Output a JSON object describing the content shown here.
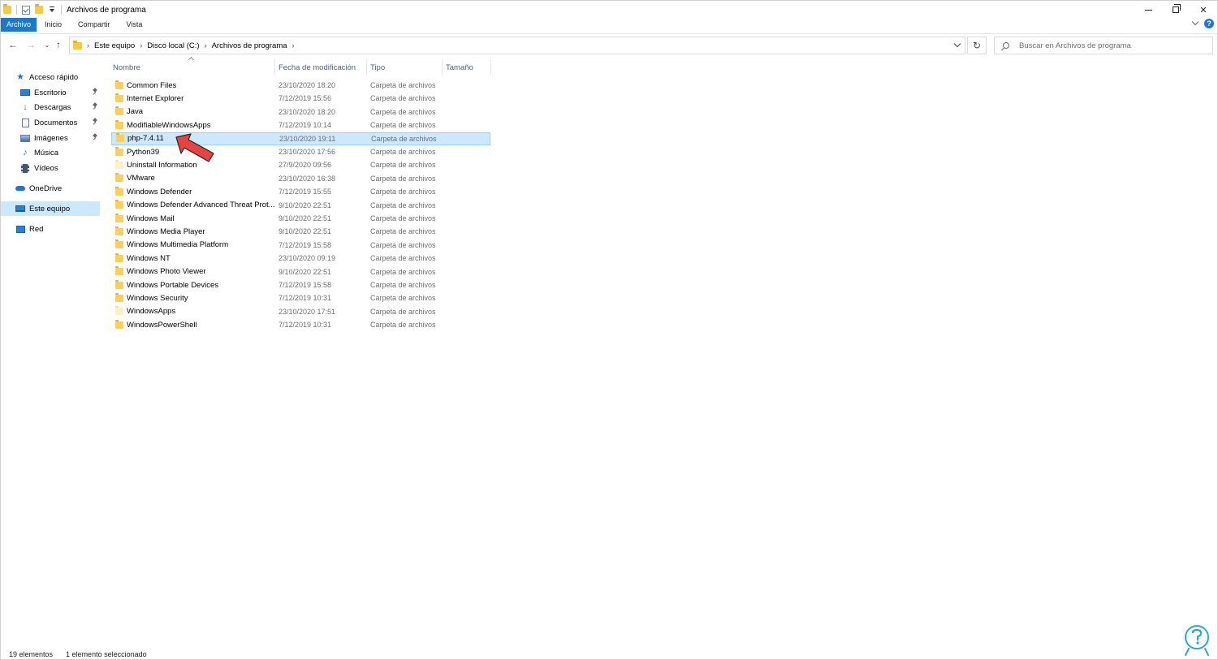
{
  "window": {
    "title": "Archivos de programa"
  },
  "ribbon": {
    "tabs": [
      "Archivo",
      "Inicio",
      "Compartir",
      "Vista"
    ]
  },
  "address": {
    "crumbs": [
      "Este equipo",
      "Disco local (C:)",
      "Archivos de programa"
    ]
  },
  "search": {
    "placeholder": "Buscar en Archivos de programa"
  },
  "sidebar": {
    "items": [
      {
        "label": "Acceso rápido",
        "icon": "star-icon"
      },
      {
        "label": "Escritorio",
        "icon": "desktop-icon",
        "pinned": true
      },
      {
        "label": "Descargas",
        "icon": "download-icon",
        "pinned": true
      },
      {
        "label": "Documentos",
        "icon": "documents-icon",
        "pinned": true
      },
      {
        "label": "Imágenes",
        "icon": "images-icon",
        "pinned": true
      },
      {
        "label": "Música",
        "icon": "music-icon"
      },
      {
        "label": "Vídeos",
        "icon": "videos-icon"
      },
      {
        "label": "OneDrive",
        "icon": "cloud-icon"
      },
      {
        "label": "Este equipo",
        "icon": "computer-icon",
        "selected": true
      },
      {
        "label": "Red",
        "icon": "network-icon"
      }
    ]
  },
  "columns": {
    "name": "Nombre",
    "date": "Fecha de modificación",
    "type": "Tipo",
    "size": "Tamaño"
  },
  "files": [
    {
      "name": "Common Files",
      "date": "23/10/2020 18:20",
      "type": "Carpeta de archivos"
    },
    {
      "name": "Internet Explorer",
      "date": "7/12/2019 15:56",
      "type": "Carpeta de archivos"
    },
    {
      "name": "Java",
      "date": "23/10/2020 18:20",
      "type": "Carpeta de archivos"
    },
    {
      "name": "ModifiableWindowsApps",
      "date": "7/12/2019 10:14",
      "type": "Carpeta de archivos"
    },
    {
      "name": "php-7.4.11",
      "date": "23/10/2020 19:11",
      "type": "Carpeta de archivos",
      "selected": true
    },
    {
      "name": "Python39",
      "date": "23/10/2020 17:56",
      "type": "Carpeta de archivos"
    },
    {
      "name": "Uninstall Information",
      "date": "27/9/2020 09:56",
      "type": "Carpeta de archivos",
      "pale": true
    },
    {
      "name": "VMware",
      "date": "23/10/2020 16:38",
      "type": "Carpeta de archivos"
    },
    {
      "name": "Windows Defender",
      "date": "7/12/2019 15:55",
      "type": "Carpeta de archivos"
    },
    {
      "name": "Windows Defender Advanced Threat Prot...",
      "date": "9/10/2020 22:51",
      "type": "Carpeta de archivos"
    },
    {
      "name": "Windows Mail",
      "date": "9/10/2020 22:51",
      "type": "Carpeta de archivos"
    },
    {
      "name": "Windows Media Player",
      "date": "9/10/2020 22:51",
      "type": "Carpeta de archivos"
    },
    {
      "name": "Windows Multimedia Platform",
      "date": "7/12/2019 15:58",
      "type": "Carpeta de archivos"
    },
    {
      "name": "Windows NT",
      "date": "23/10/2020 09:19",
      "type": "Carpeta de archivos"
    },
    {
      "name": "Windows Photo Viewer",
      "date": "9/10/2020 22:51",
      "type": "Carpeta de archivos"
    },
    {
      "name": "Windows Portable Devices",
      "date": "7/12/2019 15:58",
      "type": "Carpeta de archivos"
    },
    {
      "name": "Windows Security",
      "date": "7/12/2019 10:31",
      "type": "Carpeta de archivos"
    },
    {
      "name": "WindowsApps",
      "date": "23/10/2020 17:51",
      "type": "Carpeta de archivos",
      "pale": true
    },
    {
      "name": "WindowsPowerShell",
      "date": "7/12/2019 10:31",
      "type": "Carpeta de archivos"
    }
  ],
  "status": {
    "count": "19 elementos",
    "selection": "1 elemento seleccionado"
  },
  "colors": {
    "accent": "#1979ca",
    "selection": "#cce8ff",
    "annotation_arrow": "#e8433f",
    "watermark": "#2aa7d6"
  }
}
